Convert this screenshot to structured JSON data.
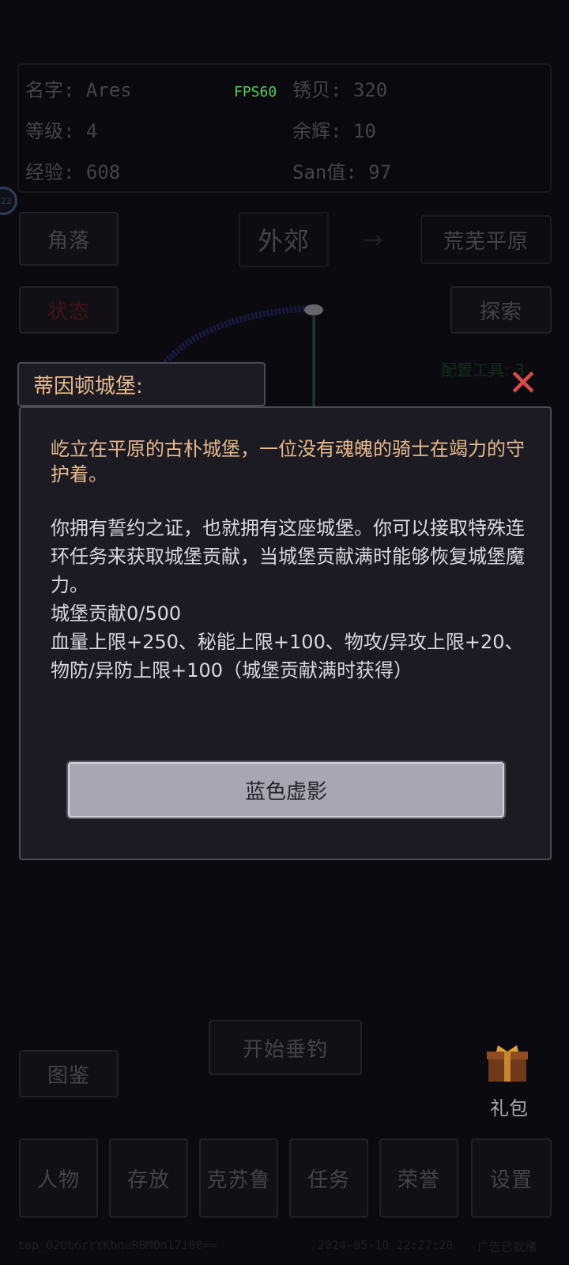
{
  "stats": {
    "name": "名字: Ares",
    "level": "等级: 4",
    "exp": "经验: 608",
    "fps": "FPS60",
    "rusty_shell": "锈贝: 320",
    "afterglow": "余辉: 10",
    "san": "San值: 97"
  },
  "side_badge": "22",
  "location": {
    "left_button": "角落",
    "current": "外郊",
    "arrow": "→",
    "right_button": "荒芜平原"
  },
  "status_button": "状态",
  "explore_button": "探索",
  "config_tools": "配置工具: 3",
  "popup": {
    "title": "蒂因顿城堡:",
    "close": "✕",
    "description": "屹立在平原的古朴城堡，一位没有魂魄的骑士在竭力的守护着。",
    "paragraph1": "你拥有誓约之证，也就拥有这座城堡。你可以接取特殊连环任务来获取城堡贡献，当城堡贡献满时能够恢复城堡魔力。",
    "contribution": "城堡贡献0/500",
    "reward": "血量上限+250、秘能上限+100、物攻/异攻上限+20、物防/异防上限+100（城堡贡献满时获得）",
    "action_button": "蓝色虚影"
  },
  "start_fishing_button": "开始垂钓",
  "codex_button": "图鉴",
  "gift_label": "礼包",
  "bottom_nav": [
    "人物",
    "存放",
    "克苏鲁",
    "任务",
    "荣誉",
    "设置"
  ],
  "footer": {
    "session_id": "tap_02Ub6rrYKbnuRBM0nl7i00==",
    "datetime": "2024-05-10 22:27:20",
    "ad_status": "广告已就绪"
  },
  "colors": {
    "accent_orange": "#e7b98c",
    "close_red": "#d94a4a",
    "fps_green": "#4fd05a"
  }
}
